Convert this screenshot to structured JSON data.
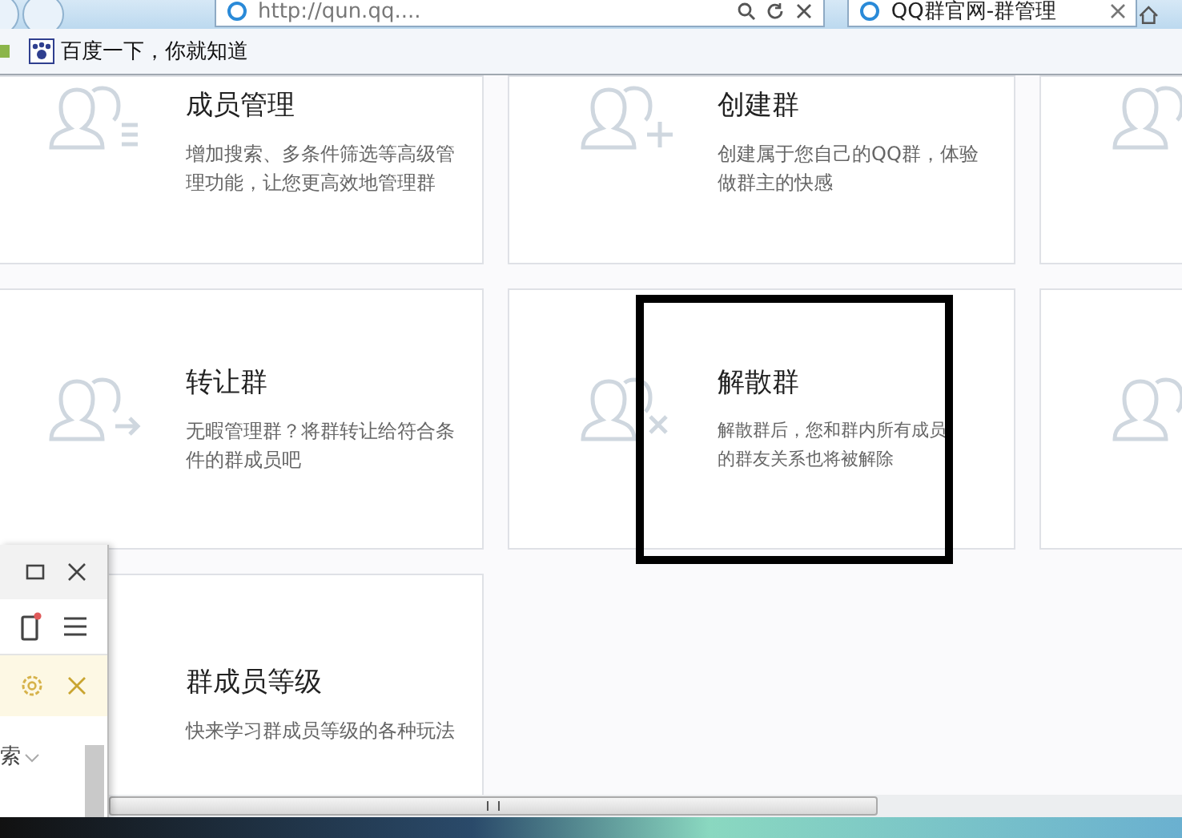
{
  "browser": {
    "address": "http://qun.qq....",
    "tab": {
      "title": "QQ群官网-群管理",
      "selected": true
    },
    "favorites": [
      "百度一下，你就知道"
    ]
  },
  "cards": [
    {
      "title": "成员管理",
      "description": "增加搜索、多条件筛选等高级管理功能，让您更高效地管理群",
      "kind": "list",
      "highlighted": false
    },
    {
      "title": "创建群",
      "description": "创建属于您自己的QQ群，体验做群主的快感",
      "kind": "add",
      "highlighted": false
    },
    {
      "kind": "plain",
      "highlighted": false
    },
    {
      "title": "转让群",
      "description": "无暇管理群？将群转让给符合条件的群成员吧",
      "kind": "transfer",
      "highlighted": false
    },
    {
      "title": "解散群",
      "description": "解散群后，您和群内所有成员的群友关系也将被解除",
      "kind": "remove",
      "highlighted": true
    },
    {
      "kind": "plain",
      "highlighted": false
    },
    {
      "title": "群成员等级",
      "description": "快来学习群成员等级的各种玩法",
      "kind": "none",
      "highlighted": false
    }
  ],
  "side_window": {
    "notification": true,
    "list_item": "索"
  }
}
